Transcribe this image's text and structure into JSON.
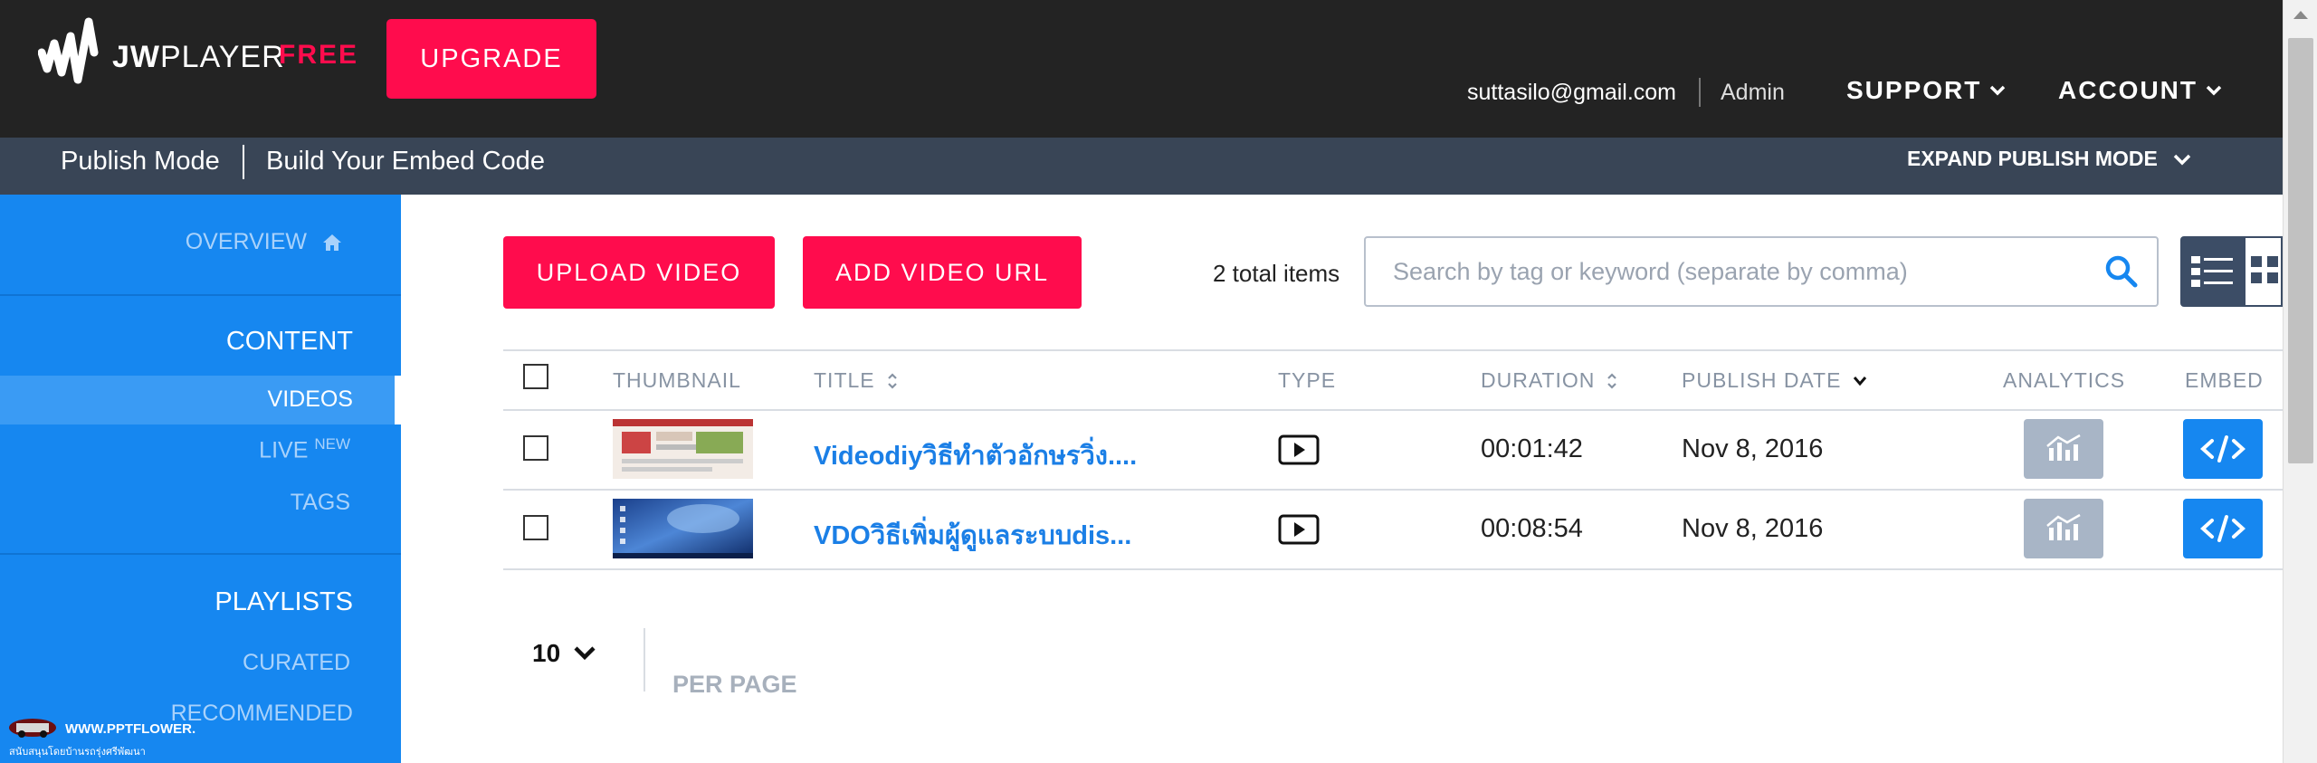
{
  "brand": {
    "logo_text_bold": "JW",
    "logo_text_rest": "PLAYER",
    "plan": "FREE",
    "upgrade_label": "UPGRADE"
  },
  "user": {
    "email": "suttasilo@gmail.com",
    "role": "Admin"
  },
  "top_menu": {
    "support": "SUPPORT",
    "account": "ACCOUNT"
  },
  "publish_bar": {
    "mode": "Publish Mode",
    "embed": "Build Your Embed Code",
    "expand": "EXPAND PUBLISH MODE"
  },
  "sidebar": {
    "overview": "OVERVIEW",
    "content_heading": "CONTENT",
    "videos": "VIDEOS",
    "live": "LIVE",
    "live_badge": "NEW",
    "tags": "TAGS",
    "playlists_heading": "PLAYLISTS",
    "curated": "CURATED",
    "recommended": "RECOMMENDED"
  },
  "watermark": {
    "line1": "WWW.PPTFLOWER.COM",
    "line2": "สนับสนุนโดยบ้านรถรุ่งศรีพัฒนา"
  },
  "actions": {
    "upload": "UPLOAD VIDEO",
    "add_url": "ADD VIDEO URL"
  },
  "total_items": "2 total items",
  "search": {
    "placeholder": "Search by tag or keyword (separate by comma)",
    "value": ""
  },
  "table": {
    "headers": {
      "thumbnail": "THUMBNAIL",
      "title": "TITLE",
      "type": "TYPE",
      "duration": "DURATION",
      "publish_date": "PUBLISH DATE",
      "analytics": "ANALYTICS",
      "embed": "EMBED"
    },
    "rows": [
      {
        "title": "Videodiyวิธีทำตัวอักษรวิ่ง....",
        "duration": "00:01:42",
        "publish_date": "Nov 8, 2016"
      },
      {
        "title": "VDOวิธีเพิ่มผู้ดูแลระบบdis...",
        "duration": "00:08:54",
        "publish_date": "Nov 8, 2016"
      }
    ]
  },
  "pagination": {
    "per_page_value": "10",
    "per_page_label": "PER PAGE"
  },
  "colors": {
    "accent_red": "#ff0c4d",
    "sidebar_blue": "#1687f0",
    "topbar": "#232323",
    "publishbar": "#394556",
    "link_blue": "#1b7fe6"
  }
}
